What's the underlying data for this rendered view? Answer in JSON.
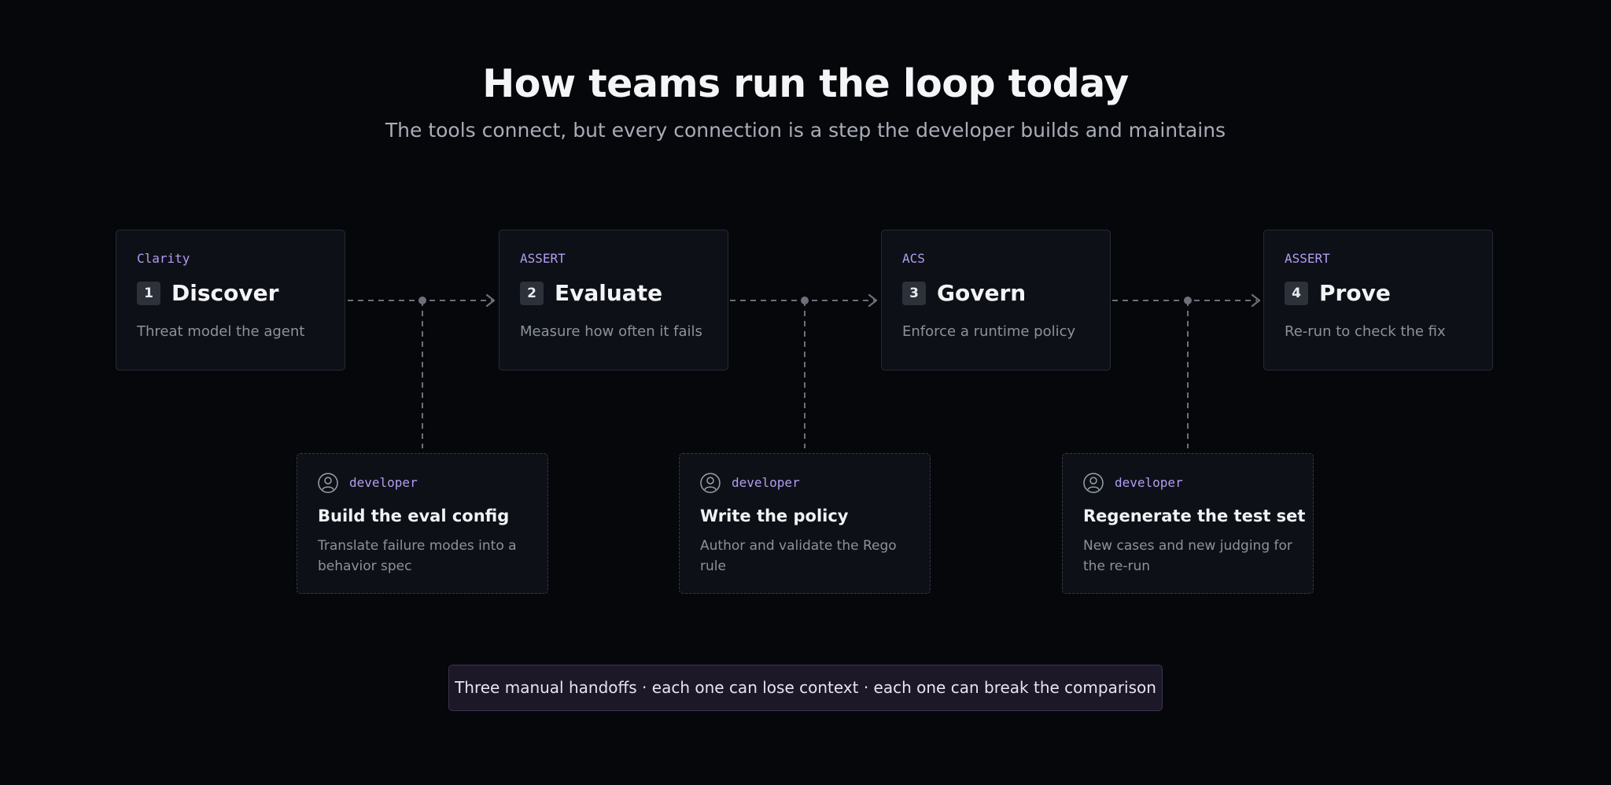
{
  "header": {
    "title": "How teams run the loop today",
    "subtitle": "The tools connect, but every connection is a step the developer builds and maintains"
  },
  "steps": [
    {
      "tool": "Clarity",
      "number": "1",
      "name": "Discover",
      "description": "Threat model the agent"
    },
    {
      "tool": "ASSERT",
      "number": "2",
      "name": "Evaluate",
      "description": "Measure how often it fails"
    },
    {
      "tool": "ACS",
      "number": "3",
      "name": "Govern",
      "description": "Enforce a runtime policy"
    },
    {
      "tool": "ASSERT",
      "number": "4",
      "name": "Prove",
      "description": "Re-run to check the fix"
    }
  ],
  "handoffs": [
    {
      "icon": "user-icon",
      "role": "developer",
      "title": "Build the eval config",
      "description": "Translate failure modes into a behavior spec"
    },
    {
      "icon": "user-icon",
      "role": "developer",
      "title": "Write the policy",
      "description": "Author and validate the Rego rule"
    },
    {
      "icon": "user-icon",
      "role": "developer",
      "title": "Regenerate the test set",
      "description": "New cases and new judging for the re-run"
    }
  ],
  "footer": {
    "banner": "Three manual handoffs · each one can lose context · each one can break the comparison"
  },
  "colors": {
    "background": "#05070b",
    "accent": "#b49cf2",
    "connector": "#6b7079"
  }
}
